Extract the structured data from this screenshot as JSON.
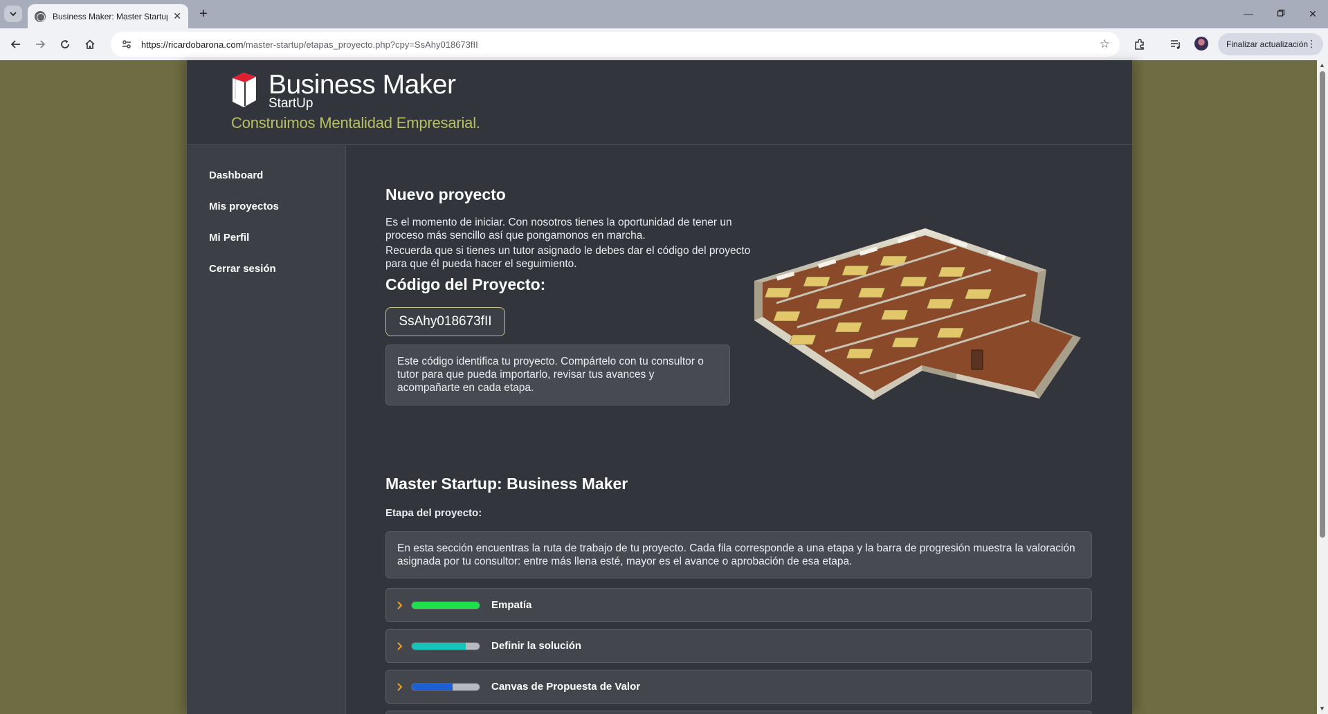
{
  "browser": {
    "tab_title": "Business Maker: Master Startup",
    "new_tab_label": "+",
    "url_host": "https://ricardobarona.com",
    "url_path": "/master-startup/etapas_proyecto.php?cpy=SsAhy018673fII",
    "update_button_label": "Finalizar actualización"
  },
  "brand": {
    "name": "Business Maker",
    "sub": "StartUp",
    "tagline": "Construimos Mentalidad Empresarial."
  },
  "sidebar": {
    "items": [
      {
        "label": "Dashboard"
      },
      {
        "label": "Mis proyectos"
      },
      {
        "label": "Mi Perfil"
      },
      {
        "label": "Cerrar sesión"
      }
    ]
  },
  "project": {
    "title": "Nuevo proyecto",
    "intro_1": "Es el momento de iniciar. Con nosotros tienes la oportunidad de tener un proceso más sencillo así que pongamonos en marcha.",
    "intro_2": "Recuerda que si tienes un tutor asignado le debes dar el código del proyecto para que él pueda hacer el seguimiento.",
    "code_heading": "Código del Proyecto:",
    "code": "SsAhy018673fII",
    "code_note": "Este código identifica tu proyecto. Compártelo con tu consultor o tutor para que pueda importarlo, revisar tus avances y acompañarte en cada etapa."
  },
  "stages": {
    "title": "Master Startup: Business Maker",
    "label": "Etapa del proyecto:",
    "note": "En esta sección encuentras la ruta de trabajo de tu proyecto. Cada fila corresponde a una etapa y la barra de progresión muestra la valoración asignada por tu consultor: entre más llena esté, mayor es el avance o aprobación de esa etapa.",
    "items": [
      {
        "name": "Empatía",
        "progress": 1.0,
        "color": "#1ee04a"
      },
      {
        "name": "Definir la solución",
        "progress": 0.8,
        "color": "#17c2b8"
      },
      {
        "name": "Canvas de Propuesta de Valor",
        "progress": 0.6,
        "color": "#1f5fd6"
      }
    ]
  },
  "colors": {
    "page_bg": "#32353b",
    "sidebar_bg": "#3c3f46",
    "tagline": "#b9bf62",
    "outer_bg": "#6e6c42",
    "chevron": "#f0a020"
  }
}
